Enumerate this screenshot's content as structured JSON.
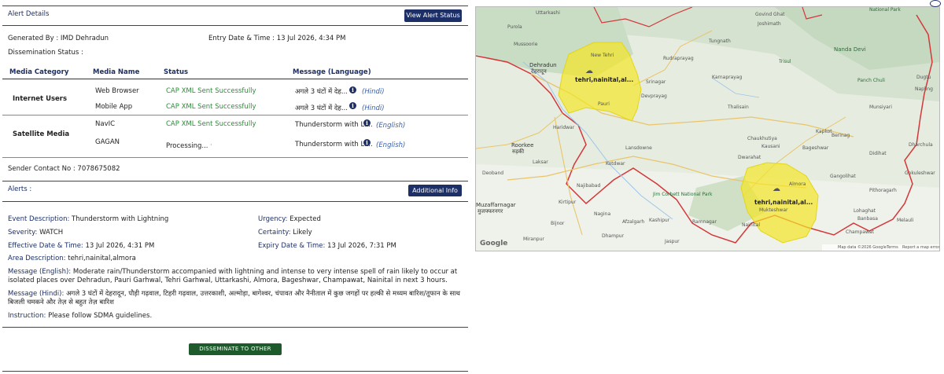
{
  "alert_details": {
    "title": "Alert Details",
    "view_button": "View Alert Status",
    "generated_by": "Generated By : IMD Dehradun",
    "entry_date": "Entry Date & Time : 13 Jul 2026, 4:34 PM",
    "dissemination_status": "Dissemination Status :",
    "headers": [
      "Media Category",
      "Media Name",
      "Status",
      "Message (Language)"
    ],
    "groups": [
      {
        "category": "Internet Users",
        "rows": [
          {
            "name": "Web Browser",
            "status": "CAP XML Sent Successfully",
            "message": "अगले 3 घंटों में देह...",
            "lang": "(Hindi)"
          },
          {
            "name": "Mobile App",
            "status": "CAP XML Sent Successfully",
            "message": "अगले 3 घंटों में देह...",
            "lang": "(Hindi)"
          }
        ]
      },
      {
        "category": "Satellite Media",
        "rows": [
          {
            "name": "NavIC",
            "status": "CAP XML Sent Successfully",
            "message": "Thunderstorm with Li...",
            "lang": "(English)"
          },
          {
            "name": "GAGAN",
            "status": "Processing...",
            "message": "Thunderstorm with Li...",
            "lang": "(English)"
          }
        ]
      }
    ],
    "sender_contact": "Sender Contact No : 7078675082"
  },
  "alerts": {
    "title": "Alerts :",
    "additional_button": "Additional Info",
    "event_label": "Event Description:",
    "event_value": "Thunderstorm with Lightning",
    "urgency_label": "Urgency:",
    "urgency_value": "Expected",
    "severity_label": "Severity:",
    "severity_value": "WATCH",
    "certainty_label": "Certainty:",
    "certainty_value": "Likely",
    "effective_label": "Effective Date & Time:",
    "effective_value": "13 Jul 2026, 4:31 PM",
    "expiry_label": "Expiry Date & Time:",
    "expiry_value": "13 Jul 2026, 7:31 PM",
    "area_label": "Area Description:",
    "area_value": "tehri,nainital,almora",
    "msg_en_label": "Message (English):",
    "msg_en_value": "Moderate rain/Thunderstorm accompanied with lightning and intense to very intense spell of rain likely to occur at isolated places over Dehradun, Pauri Garhwal, Tehri Garhwal, Uttarkashi, Almora, Bageshwar, Champawat, Nainital in next 3 hours.",
    "msg_hi_label": "Message (Hindi):",
    "msg_hi_value": "अगले 3 घंटों में देहरादून, पौड़ी गढ़वाल, टिहरी गढ़वाल, उत्तरकाशी, अल्मोड़ा, बागेश्वर, चंपावत और नैनीताल में कुछ जगहों पर हल्की से मध्यम बारिश/तूफान के साथ बिजली चमकने और तेज़ से बहुत तेज़ बारिश",
    "instruction_label": "Instruction:",
    "instruction_value": "Please follow SDMA guidelines."
  },
  "disseminate_button": "DISSEMINATE TO OTHER MEDIA",
  "map": {
    "polygon_label_1": "tehri,nainital,al...",
    "polygon_label_2": "tehri,nainital,al...",
    "places": [
      "Uttarkashi",
      "National Park",
      "Govind Ghat",
      "Joshimath",
      "Dehradun",
      "देहरादून",
      "Nanda Devi",
      "Trisul",
      "Mussoorie",
      "New Tehri",
      "Pauri",
      "Rudraprayag",
      "Karnaprayag",
      "Tungnath",
      "Panch Chuli",
      "Munsiyari",
      "Dugtu",
      "Napling",
      "Roorkee",
      "रुड़की",
      "Haridwar",
      "Muzaffarnagar",
      "मुजफ्फरनगर",
      "Bijnor",
      "Jim Corbett National Park",
      "Kotdwar",
      "Lansdowne",
      "Ramnagar",
      "Nainital",
      "Mukteshwar",
      "Almora",
      "Bageshwar",
      "Berinag",
      "Didihat",
      "Pithoragarh",
      "Champawat",
      "Dharchula",
      "Dwarahat",
      "Kausani",
      "Chaukhutiya",
      "Thalisain",
      "Kashipur",
      "Gangolihat",
      "Lohaghat",
      "Banbasa",
      "Melauli",
      "Gokuleshwar",
      "Kirtipur",
      "Najibabad",
      "Nagina",
      "Dhampur",
      "Jaspur",
      "Afzalgarh",
      "Laksar",
      "Deoband",
      "Miranpur",
      "Kapkot",
      "Purola",
      "Srinagar",
      "Devprayag"
    ],
    "footer_google": "Google",
    "footer_data": "Map data ©2026 Google",
    "footer_terms": "Terms",
    "footer_report": "Report a map error"
  },
  "colors": {
    "navy": "#1c2f66",
    "green": "#2e8b3a",
    "button_green": "#1e5a2b",
    "polygon": "#f3e626"
  }
}
